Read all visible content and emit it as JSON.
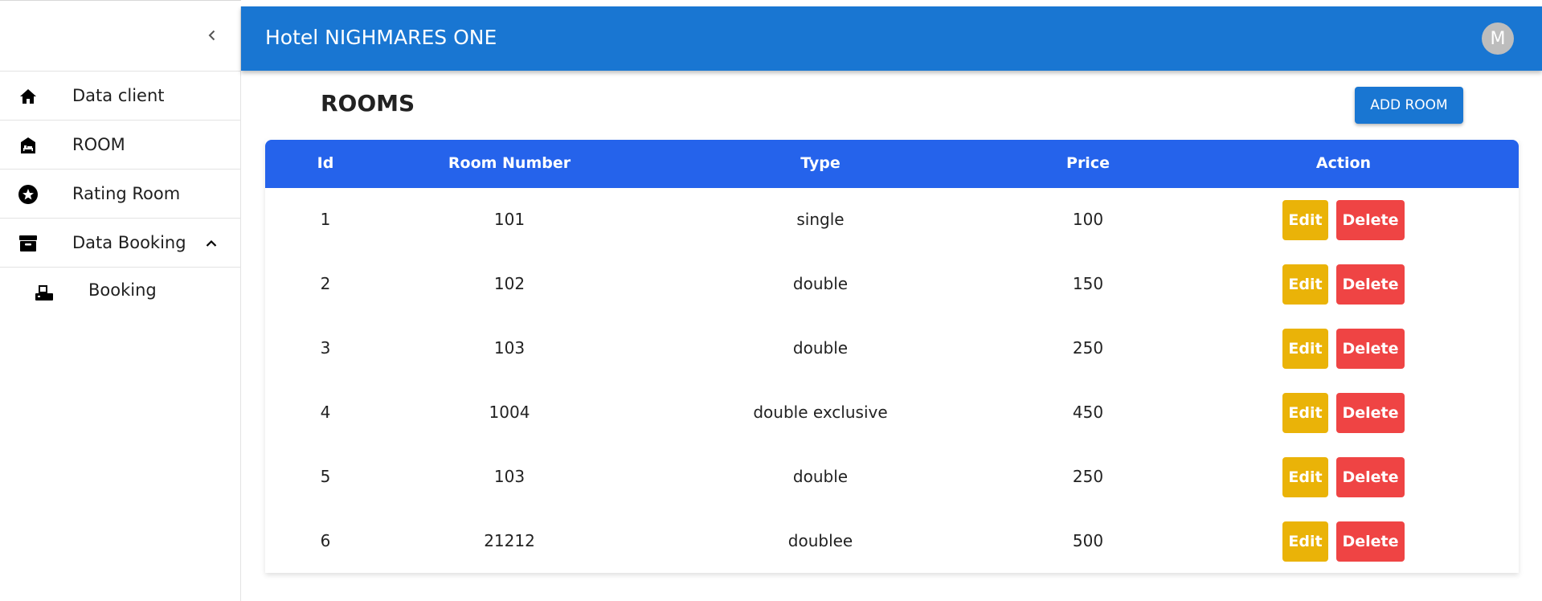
{
  "app": {
    "title": "Hotel NIGHMARES ONE",
    "avatar_initial": "M"
  },
  "sidebar": {
    "items": [
      {
        "label": "Data client",
        "icon": "home-icon"
      },
      {
        "label": "ROOM",
        "icon": "hotel-icon"
      },
      {
        "label": "Rating Room",
        "icon": "star-icon"
      },
      {
        "label": "Data Booking",
        "icon": "archive-icon",
        "expanded": true
      }
    ],
    "sub_items": [
      {
        "label": "Booking",
        "icon": "fax-icon"
      }
    ]
  },
  "main": {
    "title": "ROOMS",
    "add_button": "ADD ROOM"
  },
  "table": {
    "headers": [
      "Id",
      "Room Number",
      "Type",
      "Price",
      "Action"
    ],
    "rows": [
      {
        "id": "1",
        "room_number": "101",
        "type": "single",
        "price": "100"
      },
      {
        "id": "2",
        "room_number": "102",
        "type": "double",
        "price": "150"
      },
      {
        "id": "3",
        "room_number": "103",
        "type": "double",
        "price": "250"
      },
      {
        "id": "4",
        "room_number": "1004",
        "type": "double exclusive",
        "price": "450"
      },
      {
        "id": "5",
        "room_number": "103",
        "type": "double",
        "price": "250"
      },
      {
        "id": "6",
        "room_number": "21212",
        "type": "doublee",
        "price": "500"
      }
    ],
    "edit_label": "Edit",
    "delete_label": "Delete"
  },
  "colors": {
    "appbar": "#1976d2",
    "table_header": "#2563eb",
    "edit": "#eab308",
    "delete": "#ef4444"
  }
}
